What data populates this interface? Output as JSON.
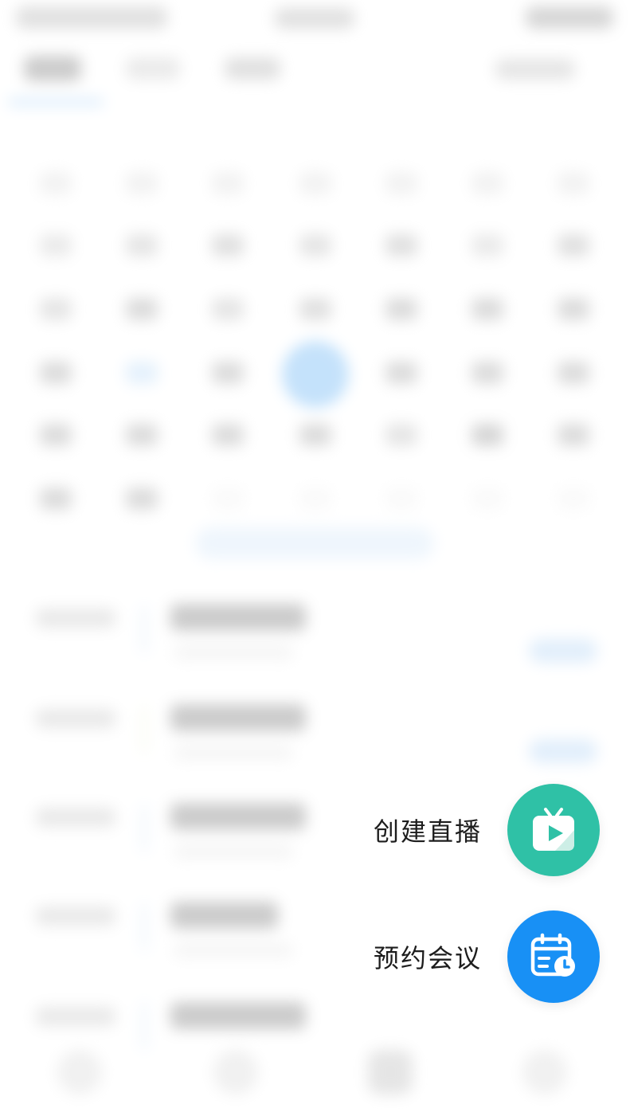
{
  "actions": {
    "live": {
      "label": "创建直播",
      "icon": "tv-play-icon",
      "color": "#2fc1a6"
    },
    "meeting": {
      "label": "预约会议",
      "icon": "calendar-clock-icon",
      "color": "#1890f5"
    }
  }
}
